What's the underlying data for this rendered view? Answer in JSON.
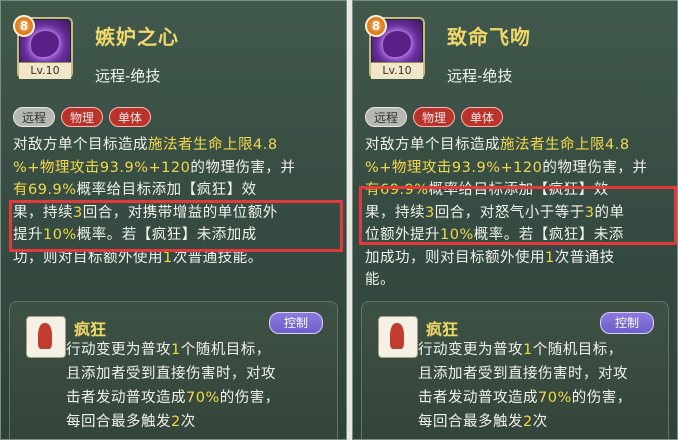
{
  "left": {
    "skill_name": "嫉妒之心",
    "skill_type": "远程-绝技",
    "level": "Lv.10",
    "badge": "8",
    "tags": [
      "远程",
      "物理",
      "单体"
    ],
    "desc": {
      "l1a": "对敌方单个目标造成",
      "l1b": "施法者生命上限4.8",
      "l2a": "%+物理攻击93.9%+120",
      "l2b": "的物理伤害，并",
      "l3a": "有69.9%",
      "l3b": "概率给目标添加【疯狂】效",
      "l4a": "果，持续",
      "l4b": "3",
      "l4c": "回合，对携带增益的单位额外",
      "l5a": "提升",
      "l5b": "10%",
      "l5c": "概率。若【疯狂】未添加成",
      "l6a": "功，则对目标额外使用",
      "l6b": "1",
      "l6c": "次普通技能。"
    },
    "status": {
      "name": "疯狂",
      "control": "控制",
      "line1a": "行动变更为普攻",
      "line1b": "1",
      "line1c": "个随机目标，",
      "line2": "且添加者受到直接伤害时，对攻",
      "line3a": "击者发动普攻造成",
      "line3b": "70%",
      "line3c": "的伤害，",
      "line4a": "每回合最多触发",
      "line4b": "2",
      "line4c": "次"
    }
  },
  "right": {
    "skill_name": "致命飞吻",
    "skill_type": "远程-绝技",
    "level": "Lv.10",
    "badge": "8",
    "tags": [
      "远程",
      "物理",
      "单体"
    ],
    "desc": {
      "l1a": "对敌方单个目标造成",
      "l1b": "施法者生命上限4.8",
      "l2a": "%+物理攻击93.9%+120",
      "l2b": "的物理伤害，并",
      "l3a": "有69.9%",
      "l3b": "概率给目标添加【疯狂】效",
      "l4a": "果，持续",
      "l4b": "3",
      "l4c": "回合，对怒气小于等于",
      "l4d": "3",
      "l4e": "的单",
      "l5a": "位额外提升",
      "l5b": "10%",
      "l5c": "概率。若【疯狂】未添",
      "l6a": "加成功，则对目标额外使用",
      "l6b": "1",
      "l6c": "次普通技",
      "l7": "能。"
    },
    "status": {
      "name": "疯狂",
      "control": "控制",
      "line1a": "行动变更为普攻",
      "line1b": "1",
      "line1c": "个随机目标，",
      "line2": "且添加者受到直接伤害时，对攻",
      "line3a": "击者发动普攻造成",
      "line3b": "70%",
      "line3c": "的伤害，",
      "line4a": "每回合最多触发",
      "line4b": "2",
      "line4c": "次"
    }
  }
}
